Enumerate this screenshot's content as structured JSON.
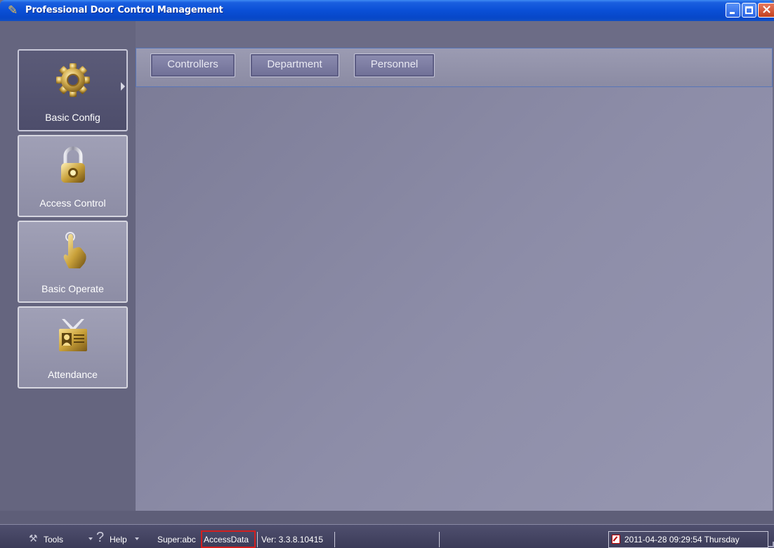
{
  "window": {
    "title": "Professional Door Control Management",
    "buttons": {
      "minimize": "minimize",
      "maximize": "maximize",
      "close": "×"
    }
  },
  "sidebar": {
    "items": [
      {
        "label": "Basic Config",
        "icon": "gear-icon",
        "active": true
      },
      {
        "label": "Access Control",
        "icon": "padlock-icon",
        "active": false
      },
      {
        "label": "Basic Operate",
        "icon": "pointing-hand-icon",
        "active": false
      },
      {
        "label": "Attendance",
        "icon": "id-badge-icon",
        "active": false
      }
    ]
  },
  "tabs": [
    {
      "label": "Controllers"
    },
    {
      "label": "Department"
    },
    {
      "label": "Personnel"
    }
  ],
  "statusbar": {
    "tools_label": "Tools",
    "help_label": "Help",
    "user": "Super:abc",
    "database": "AccessData",
    "version": "Ver: 3.3.8.10415",
    "datetime": "2011-04-28 09:29:54 Thursday"
  },
  "colors": {
    "titlebar": "#0a4fd6",
    "sidebar_bg": "#65657f",
    "workspace": "#8d8da8",
    "icon_gold": "#c9a13a",
    "highlight_box": "#d21f1f"
  }
}
